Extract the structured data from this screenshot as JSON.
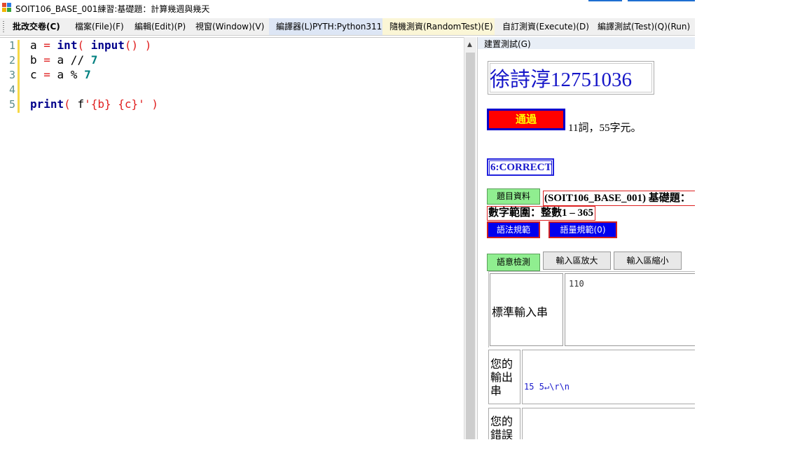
{
  "window": {
    "title": "SOIT106_BASE_001練習:基礎題：計算幾週與幾天"
  },
  "menu": [
    {
      "label": "批改交卷(C)"
    },
    {
      "label": "檔案(File)(F)"
    },
    {
      "label": "編輯(Edit)(P)"
    },
    {
      "label": "視窗(Window)(V)"
    },
    {
      "label": "編譯器(L)PYTH:Python311"
    },
    {
      "label": "隨機測資(RandomTest)(E)"
    },
    {
      "label": "自訂測資(Execute)(D)"
    },
    {
      "label": "編譯測試(Test)(Q)(Run)"
    }
  ],
  "editor": {
    "line_numbers": [
      "1",
      "2",
      "3",
      "4",
      "5"
    ],
    "lines": [
      [
        {
          "t": "a "
        },
        {
          "t": "=",
          "c": "op"
        },
        {
          "t": " "
        },
        {
          "t": "int",
          "c": "kw"
        },
        {
          "t": "( ",
          "c": "op"
        },
        {
          "t": "input",
          "c": "kw"
        },
        {
          "t": "() )",
          "c": "op"
        }
      ],
      [
        {
          "t": "b "
        },
        {
          "t": "=",
          "c": "op"
        },
        {
          "t": " a // "
        },
        {
          "t": "7",
          "c": "num"
        }
      ],
      [
        {
          "t": "c "
        },
        {
          "t": "=",
          "c": "op"
        },
        {
          "t": " a % "
        },
        {
          "t": "7",
          "c": "num"
        }
      ],
      [],
      [
        {
          "t": "print",
          "c": "kw"
        },
        {
          "t": "( ",
          "c": "op"
        },
        {
          "t": "f"
        },
        {
          "t": "'{b} {c}'",
          "c": "str"
        },
        {
          "t": " )",
          "c": "op"
        }
      ]
    ]
  },
  "panel": {
    "header": "建置測試(G)",
    "student": "徐詩淳12751036",
    "status_button": "通過",
    "stats": "11詞，55字元。",
    "result": "6:CORRECT",
    "topic_button": "題目資料",
    "topic_title": "(SOIT106_BASE_001) 基礎題：",
    "range": "數字範圍：整數1 – 365",
    "syntax_button": "語法規範",
    "quota_button": "語量規範(0)",
    "semantic_button": "語意檢測",
    "zoom_in_button": "輸入區放大",
    "zoom_out_button": "輸入區縮小",
    "stdin_label": "標準輸入串",
    "stdin_value": "110",
    "output_label": "您的輸出串",
    "output_value": "15 5↵\\r\\n",
    "error_label": "您的錯誤"
  },
  "colors": {
    "title_accent": "#1e6fd1",
    "pass_bg": "#ff0000",
    "pass_text": "#ffff00",
    "link_blue": "#1515c8",
    "button_blue": "#0000ee",
    "button_green": "#90ee90"
  }
}
